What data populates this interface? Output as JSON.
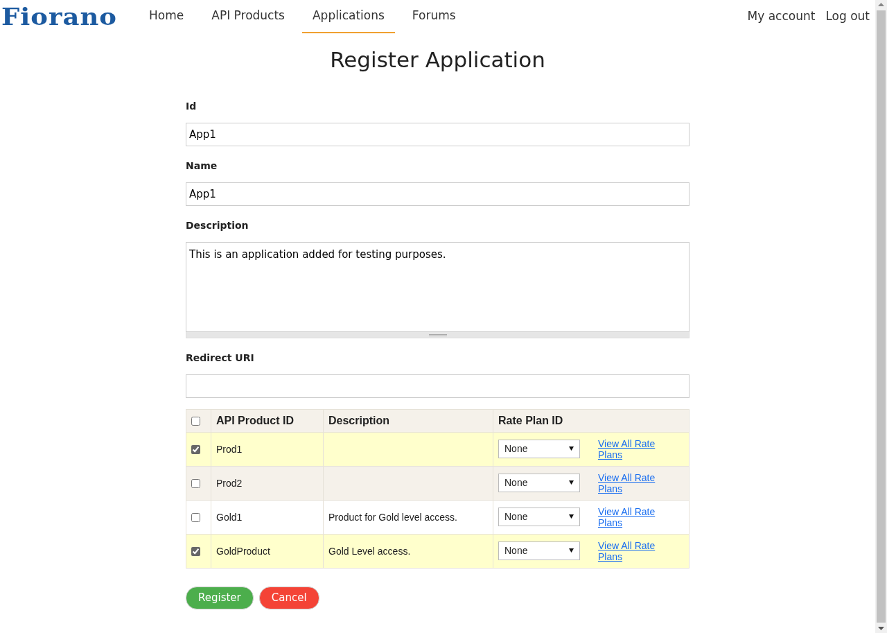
{
  "logo": "Fiorano",
  "nav": [
    {
      "label": "Home",
      "selected": false
    },
    {
      "label": "API Products",
      "selected": false
    },
    {
      "label": "Applications",
      "selected": true
    },
    {
      "label": "Forums",
      "selected": false
    }
  ],
  "account_links": [
    "My account",
    "Log out"
  ],
  "title": "Register Application",
  "fields": [
    {
      "label": "Id",
      "kind": "input",
      "value": "App1"
    },
    {
      "label": "Name",
      "kind": "input",
      "value": "App1"
    },
    {
      "label": "Description",
      "kind": "textarea",
      "value": "This is an application added for testing purposes."
    },
    {
      "label": "Redirect URI",
      "kind": "input"
    }
  ],
  "table": {
    "select_all": {
      "checked": false
    },
    "columns": [
      "API Product ID",
      "Description",
      "Rate Plan ID"
    ],
    "rows": [
      {
        "checked": true,
        "id": "Prod1",
        "rate_plan": "None",
        "link": "View All Rate Plans"
      },
      {
        "checked": false,
        "id": "Prod2",
        "rate_plan": "None",
        "link": "View All Rate Plans"
      },
      {
        "checked": false,
        "id": "Gold1",
        "description": "Product for Gold level access.",
        "rate_plan": "None",
        "link": "View All Rate Plans"
      },
      {
        "checked": true,
        "id": "GoldProduct",
        "description": "Gold Level access.",
        "rate_plan": "None",
        "link": "View All Rate Plans"
      }
    ]
  },
  "buttons": [
    {
      "label": "Register",
      "kind": "primary"
    },
    {
      "label": "Cancel",
      "kind": "danger"
    }
  ]
}
